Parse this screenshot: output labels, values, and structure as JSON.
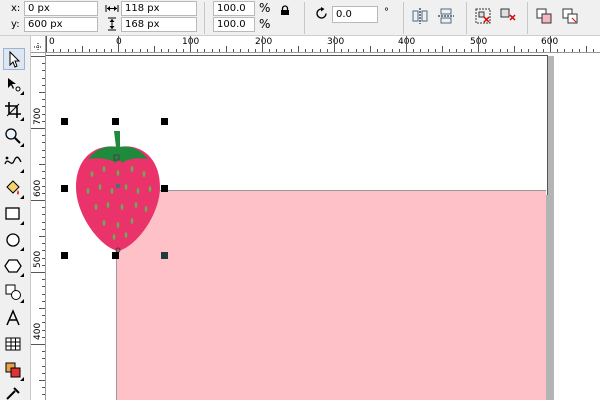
{
  "property_bar": {
    "x_label": "x:",
    "x_value": "0 px",
    "y_label": "y:",
    "y_value": "600 px",
    "width_value": "118 px",
    "height_value": "168 px",
    "scale_x_value": "100.0",
    "scale_y_value": "100.0",
    "percent_symbol": "%",
    "rotation_value": "0.0",
    "degree_symbol": "°"
  },
  "rulers": {
    "horizontal_labels": [
      "0",
      "0",
      "100",
      "200",
      "300",
      "400",
      "500",
      "600"
    ],
    "vertical_labels": [
      "700",
      "600",
      "500",
      "400"
    ]
  },
  "toolbox": {
    "tools": [
      "pick-tool",
      "shape-tool",
      "crop-tool",
      "zoom-tool",
      "freehand-tool",
      "smart-fill-tool",
      "rectangle-tool",
      "ellipse-tool",
      "polygon-tool",
      "basic-shapes-tool",
      "text-tool",
      "table-tool",
      "interactive-fill-tool",
      "eyedropper-tool"
    ],
    "active_tool": "pick-tool"
  },
  "canvas": {
    "rectangle_fill": "#fdc1c7",
    "strawberry_body": "#e9336a",
    "strawberry_leaves": "#1f8a3c",
    "strawberry_seeds": "#6fa85a"
  }
}
